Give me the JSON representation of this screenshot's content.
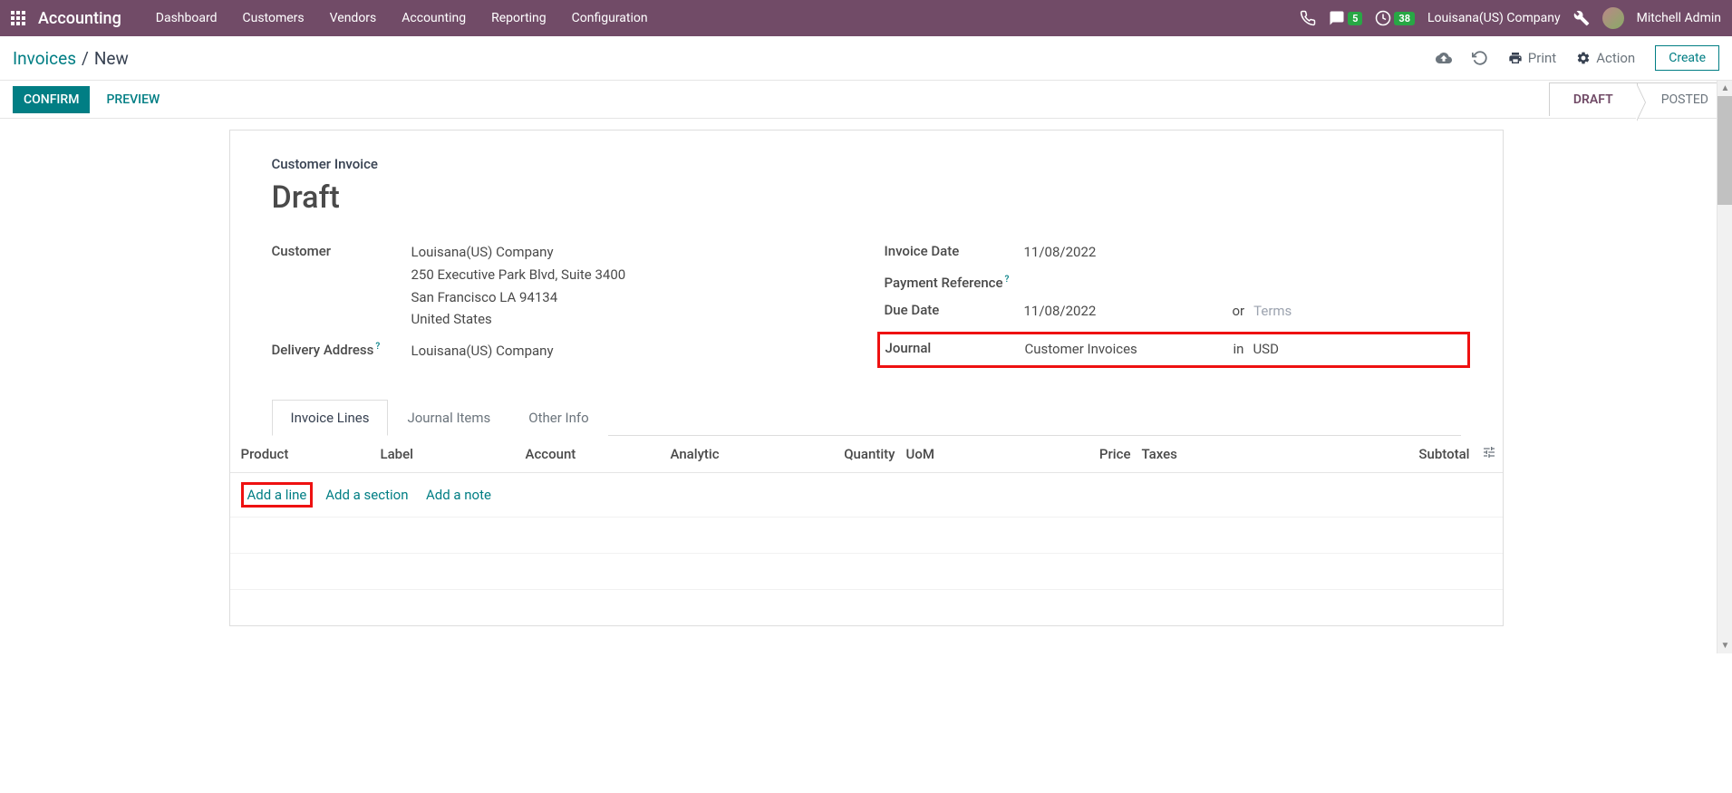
{
  "navbar": {
    "brand": "Accounting",
    "menu": [
      "Dashboard",
      "Customers",
      "Vendors",
      "Accounting",
      "Reporting",
      "Configuration"
    ],
    "messages_badge": "5",
    "activities_badge": "38",
    "company": "Louisana(US) Company",
    "user": "Mitchell Admin"
  },
  "breadcrumb": {
    "root": "Invoices",
    "sep": "/",
    "current": "New",
    "print": "Print",
    "action": "Action",
    "create": "Create"
  },
  "statusbar": {
    "confirm": "CONFIRM",
    "preview": "PREVIEW",
    "stages": {
      "draft": "DRAFT",
      "posted": "POSTED"
    }
  },
  "form": {
    "type_label": "Customer Invoice",
    "title": "Draft",
    "left": {
      "customer_label": "Customer",
      "customer_name": "Louisana(US) Company",
      "customer_addr1": "250 Executive Park Blvd, Suite 3400",
      "customer_addr2": "San Francisco LA 94134",
      "customer_country": "United States",
      "delivery_label": "Delivery Address",
      "delivery_value": "Louisana(US) Company"
    },
    "right": {
      "invoice_date_label": "Invoice Date",
      "invoice_date": "11/08/2022",
      "payment_ref_label": "Payment Reference",
      "due_date_label": "Due Date",
      "due_date": "11/08/2022",
      "or": "or",
      "terms_placeholder": "Terms",
      "journal_label": "Journal",
      "journal_value": "Customer Invoices",
      "in": "in",
      "currency": "USD"
    }
  },
  "tabs": {
    "invoice_lines": "Invoice Lines",
    "journal_items": "Journal Items",
    "other_info": "Other Info"
  },
  "table": {
    "headers": {
      "product": "Product",
      "label": "Label",
      "account": "Account",
      "analytic": "Analytic",
      "quantity": "Quantity",
      "uom": "UoM",
      "price": "Price",
      "taxes": "Taxes",
      "subtotal": "Subtotal"
    },
    "add_line": "Add a line",
    "add_section": "Add a section",
    "add_note": "Add a note"
  }
}
